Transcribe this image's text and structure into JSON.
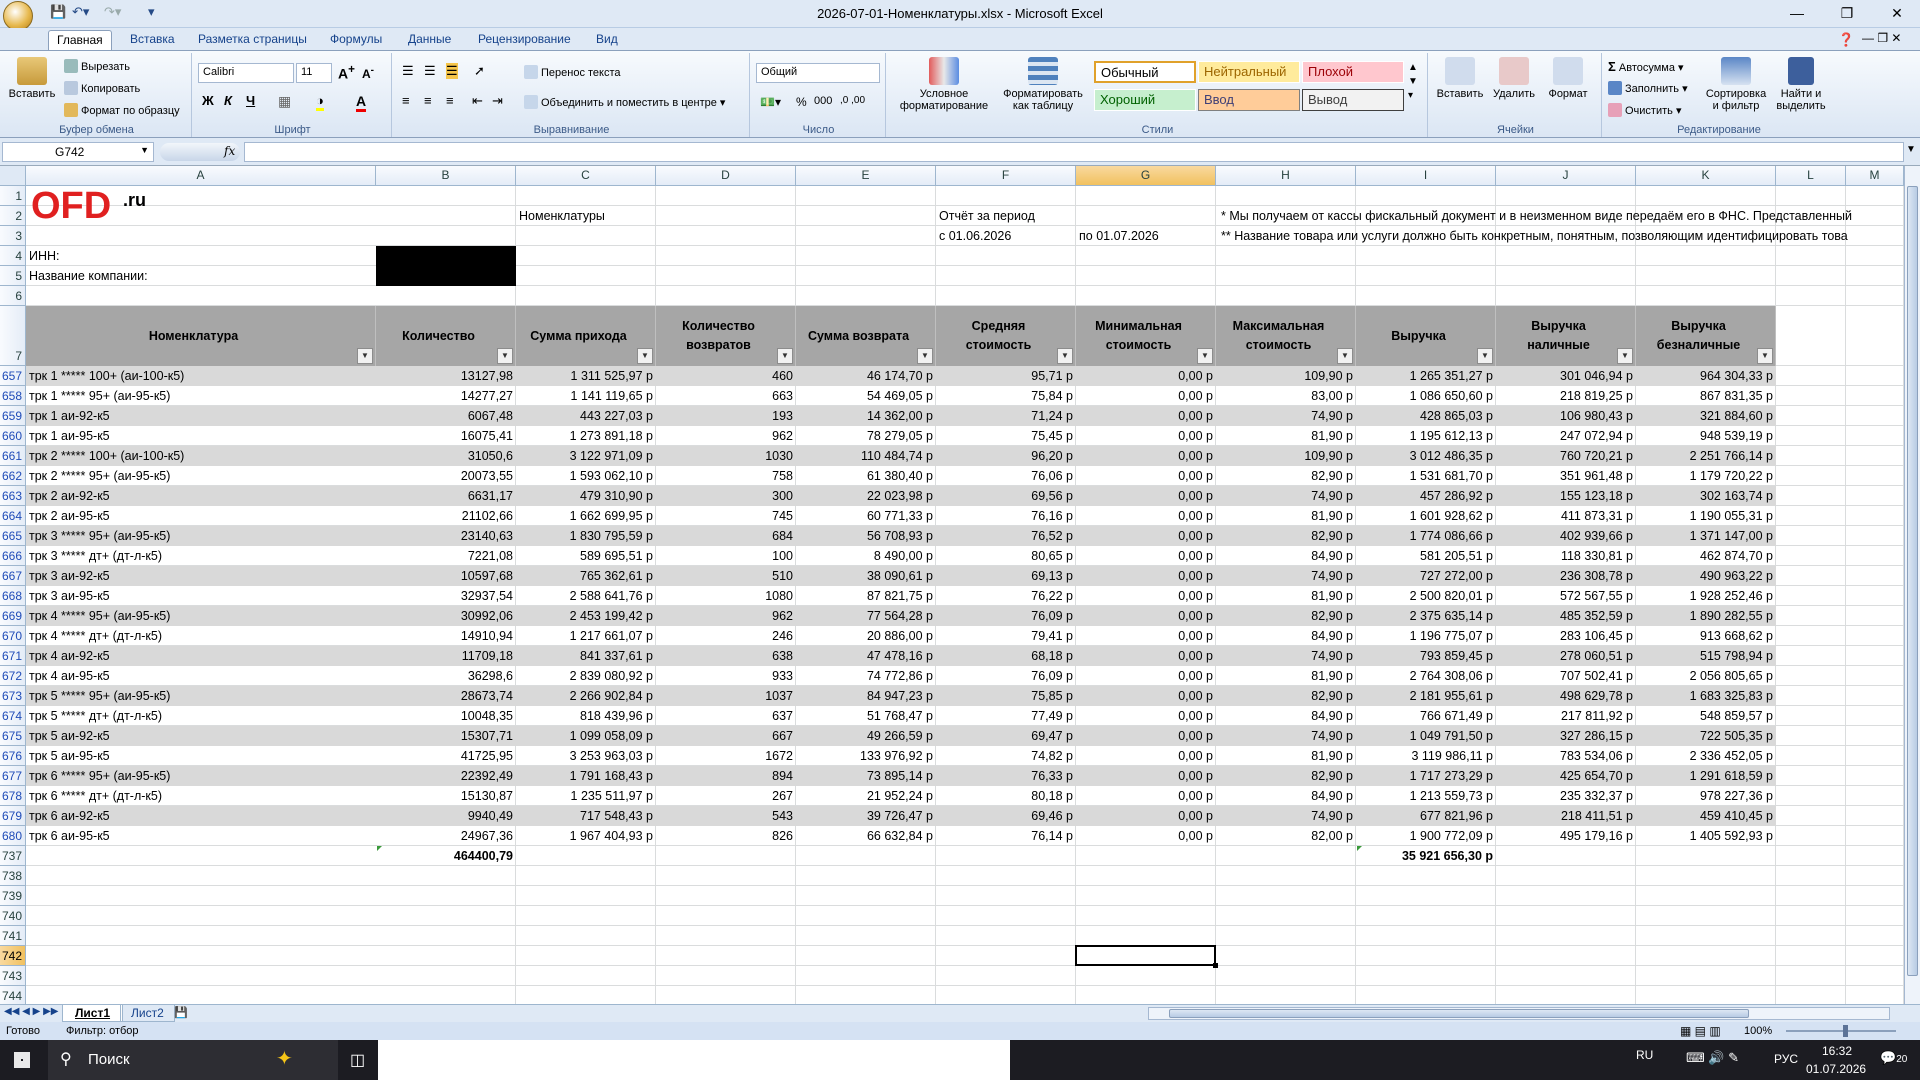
{
  "titlebar": {
    "title": "2026-07-01-Номенклатуры.xlsx - Microsoft Excel"
  },
  "ribbon_tabs": [
    "Главная",
    "Вставка",
    "Разметка страницы",
    "Формулы",
    "Данные",
    "Рецензирование",
    "Вид"
  ],
  "ribbon": {
    "clipboard": {
      "paste": "Вставить",
      "cut": "Вырезать",
      "copy": "Копировать",
      "format_painter": "Формат по образцу",
      "label": "Буфер обмена"
    },
    "font": {
      "name": "Calibri",
      "size": "11",
      "label": "Шрифт"
    },
    "alignment": {
      "wrap": "Перенос текста",
      "merge": "Объединить и поместить в центре",
      "label": "Выравнивание"
    },
    "number": {
      "format": "Общий",
      "label": "Число"
    },
    "styles": {
      "conditional": "Условное форматирование",
      "as_table": "Форматировать как таблицу",
      "normal": "Обычный",
      "neutral": "Нейтральный",
      "bad": "Плохой",
      "good": "Хороший",
      "input": "Ввод",
      "output": "Вывод",
      "label": "Стили"
    },
    "cells": {
      "insert": "Вставить",
      "delete": "Удалить",
      "format": "Формат",
      "label": "Ячейки"
    },
    "editing": {
      "autosum": "Автосумма",
      "fill": "Заполнить",
      "clear": "Очистить",
      "sort": "Сортировка и фильтр",
      "find": "Найти и выделить",
      "label": "Редактирование"
    }
  },
  "formula_bar": {
    "name_box": "G742",
    "fx": "fx",
    "formula": ""
  },
  "columns": [
    "A",
    "B",
    "C",
    "D",
    "E",
    "F",
    "G",
    "H",
    "I",
    "J",
    "K",
    "L",
    "M"
  ],
  "selected_col": "G",
  "logo": {
    "text": "OFD",
    "suffix": ".ru"
  },
  "sheet_top": {
    "inn_label": "ИНН:",
    "company_label": "Название компании:",
    "nomenclature": "Номенклатуры",
    "report_period": "Отчёт за период",
    "from": "с 01.06.2026",
    "to": "по 01.07.2026",
    "note1": "* Мы получаем от кассы фискальный документ и в неизменном виде передаём его в ФНС. Представленный",
    "note2": "** Название товара или услуги должно быть конкретным, понятным, позволяющим идентифицировать това"
  },
  "table_headers": [
    "Номенклатура",
    "Количество",
    "Сумма прихода",
    "Количество возвратов",
    "Сумма возврата",
    "Средняя стоимость",
    "Минимальная стоимость",
    "Максимальная стоимость",
    "Выручка",
    "Выручка наличные",
    "Выручка безналичные"
  ],
  "rows": [
    [
      "657",
      "трк 1 ***** 100+ (аи-100-к5)",
      "13127,98",
      "1 311 525,97 р",
      "460",
      "46 174,70 р",
      "95,71 р",
      "0,00 р",
      "109,90 р",
      "1 265 351,27 р",
      "301 046,94 р",
      "964 304,33 р"
    ],
    [
      "658",
      "трк 1 ***** 95+ (аи-95-к5)",
      "14277,27",
      "1 141 119,65 р",
      "663",
      "54 469,05 р",
      "75,84 р",
      "0,00 р",
      "83,00 р",
      "1 086 650,60 р",
      "218 819,25 р",
      "867 831,35 р"
    ],
    [
      "659",
      "трк 1 аи-92-к5",
      "6067,48",
      "443 227,03 р",
      "193",
      "14 362,00 р",
      "71,24 р",
      "0,00 р",
      "74,90 р",
      "428 865,03 р",
      "106 980,43 р",
      "321 884,60 р"
    ],
    [
      "660",
      "трк 1 аи-95-к5",
      "16075,41",
      "1 273 891,18 р",
      "962",
      "78 279,05 р",
      "75,45 р",
      "0,00 р",
      "81,90 р",
      "1 195 612,13 р",
      "247 072,94 р",
      "948 539,19 р"
    ],
    [
      "661",
      "трк 2 ***** 100+ (аи-100-к5)",
      "31050,6",
      "3 122 971,09 р",
      "1030",
      "110 484,74 р",
      "96,20 р",
      "0,00 р",
      "109,90 р",
      "3 012 486,35 р",
      "760 720,21 р",
      "2 251 766,14 р"
    ],
    [
      "662",
      "трк 2 ***** 95+ (аи-95-к5)",
      "20073,55",
      "1 593 062,10 р",
      "758",
      "61 380,40 р",
      "76,06 р",
      "0,00 р",
      "82,90 р",
      "1 531 681,70 р",
      "351 961,48 р",
      "1 179 720,22 р"
    ],
    [
      "663",
      "трк 2 аи-92-к5",
      "6631,17",
      "479 310,90 р",
      "300",
      "22 023,98 р",
      "69,56 р",
      "0,00 р",
      "74,90 р",
      "457 286,92 р",
      "155 123,18 р",
      "302 163,74 р"
    ],
    [
      "664",
      "трк 2 аи-95-к5",
      "21102,66",
      "1 662 699,95 р",
      "745",
      "60 771,33 р",
      "76,16 р",
      "0,00 р",
      "81,90 р",
      "1 601 928,62 р",
      "411 873,31 р",
      "1 190 055,31 р"
    ],
    [
      "665",
      "трк 3 ***** 95+ (аи-95-к5)",
      "23140,63",
      "1 830 795,59 р",
      "684",
      "56 708,93 р",
      "76,52 р",
      "0,00 р",
      "82,90 р",
      "1 774 086,66 р",
      "402 939,66 р",
      "1 371 147,00 р"
    ],
    [
      "666",
      "трк 3 ***** дт+ (дт-л-к5)",
      "7221,08",
      "589 695,51 р",
      "100",
      "8 490,00 р",
      "80,65 р",
      "0,00 р",
      "84,90 р",
      "581 205,51 р",
      "118 330,81 р",
      "462 874,70 р"
    ],
    [
      "667",
      "трк 3 аи-92-к5",
      "10597,68",
      "765 362,61 р",
      "510",
      "38 090,61 р",
      "69,13 р",
      "0,00 р",
      "74,90 р",
      "727 272,00 р",
      "236 308,78 р",
      "490 963,22 р"
    ],
    [
      "668",
      "трк 3 аи-95-к5",
      "32937,54",
      "2 588 641,76 р",
      "1080",
      "87 821,75 р",
      "76,22 р",
      "0,00 р",
      "81,90 р",
      "2 500 820,01 р",
      "572 567,55 р",
      "1 928 252,46 р"
    ],
    [
      "669",
      "трк 4 ***** 95+ (аи-95-к5)",
      "30992,06",
      "2 453 199,42 р",
      "962",
      "77 564,28 р",
      "76,09 р",
      "0,00 р",
      "82,90 р",
      "2 375 635,14 р",
      "485 352,59 р",
      "1 890 282,55 р"
    ],
    [
      "670",
      "трк 4 ***** дт+ (дт-л-к5)",
      "14910,94",
      "1 217 661,07 р",
      "246",
      "20 886,00 р",
      "79,41 р",
      "0,00 р",
      "84,90 р",
      "1 196 775,07 р",
      "283 106,45 р",
      "913 668,62 р"
    ],
    [
      "671",
      "трк 4 аи-92-к5",
      "11709,18",
      "841 337,61 р",
      "638",
      "47 478,16 р",
      "68,18 р",
      "0,00 р",
      "74,90 р",
      "793 859,45 р",
      "278 060,51 р",
      "515 798,94 р"
    ],
    [
      "672",
      "трк 4 аи-95-к5",
      "36298,6",
      "2 839 080,92 р",
      "933",
      "74 772,86 р",
      "76,09 р",
      "0,00 р",
      "81,90 р",
      "2 764 308,06 р",
      "707 502,41 р",
      "2 056 805,65 р"
    ],
    [
      "673",
      "трк 5 ***** 95+ (аи-95-к5)",
      "28673,74",
      "2 266 902,84 р",
      "1037",
      "84 947,23 р",
      "75,85 р",
      "0,00 р",
      "82,90 р",
      "2 181 955,61 р",
      "498 629,78 р",
      "1 683 325,83 р"
    ],
    [
      "674",
      "трк 5 ***** дт+ (дт-л-к5)",
      "10048,35",
      "818 439,96 р",
      "637",
      "51 768,47 р",
      "77,49 р",
      "0,00 р",
      "84,90 р",
      "766 671,49 р",
      "217 811,92 р",
      "548 859,57 р"
    ],
    [
      "675",
      "трк 5 аи-92-к5",
      "15307,71",
      "1 099 058,09 р",
      "667",
      "49 266,59 р",
      "69,47 р",
      "0,00 р",
      "74,90 р",
      "1 049 791,50 р",
      "327 286,15 р",
      "722 505,35 р"
    ],
    [
      "676",
      "трк 5 аи-95-к5",
      "41725,95",
      "3 253 963,03 р",
      "1672",
      "133 976,92 р",
      "74,82 р",
      "0,00 р",
      "81,90 р",
      "3 119 986,11 р",
      "783 534,06 р",
      "2 336 452,05 р"
    ],
    [
      "677",
      "трк 6 ***** 95+ (аи-95-к5)",
      "22392,49",
      "1 791 168,43 р",
      "894",
      "73 895,14 р",
      "76,33 р",
      "0,00 р",
      "82,90 р",
      "1 717 273,29 р",
      "425 654,70 р",
      "1 291 618,59 р"
    ],
    [
      "678",
      "трк 6 ***** дт+ (дт-л-к5)",
      "15130,87",
      "1 235 511,97 р",
      "267",
      "21 952,24 р",
      "80,18 р",
      "0,00 р",
      "84,90 р",
      "1 213 559,73 р",
      "235 332,37 р",
      "978 227,36 р"
    ],
    [
      "679",
      "трк 6 аи-92-к5",
      "9940,49",
      "717 548,43 р",
      "543",
      "39 726,47 р",
      "69,46 р",
      "0,00 р",
      "74,90 р",
      "677 821,96 р",
      "218 411,51 р",
      "459 410,45 р"
    ],
    [
      "680",
      "трк 6 аи-95-к5",
      "24967,36",
      "1 967 404,93 р",
      "826",
      "66 632,84 р",
      "76,14 р",
      "0,00 р",
      "82,00 р",
      "1 900 772,09 р",
      "495 179,16 р",
      "1 405 592,93 р"
    ]
  ],
  "totals": {
    "row": "737",
    "qty": "464400,79",
    "revenue": "35 921 656,30 р"
  },
  "empty_rows": [
    "738",
    "739",
    "740",
    "741",
    "742",
    "743",
    "744"
  ],
  "top_rows": [
    "1",
    "2",
    "3",
    "4",
    "5",
    "6",
    "7"
  ],
  "sheets": [
    "Лист1",
    "Лист2"
  ],
  "status": {
    "ready": "Готово",
    "filter": "Фильтр: отбор",
    "zoom": "100%"
  },
  "taskbar": {
    "search": "Поиск",
    "lang1": "RU",
    "lang2": "РУС",
    "time": "16:32",
    "date": "01.07.2026",
    "notif": "20"
  },
  "colors": {
    "header_bg": "#a6a6a6",
    "row_alt": "#d9d9d9",
    "selected": "#f1c15f",
    "logo_red": "#e02020"
  }
}
